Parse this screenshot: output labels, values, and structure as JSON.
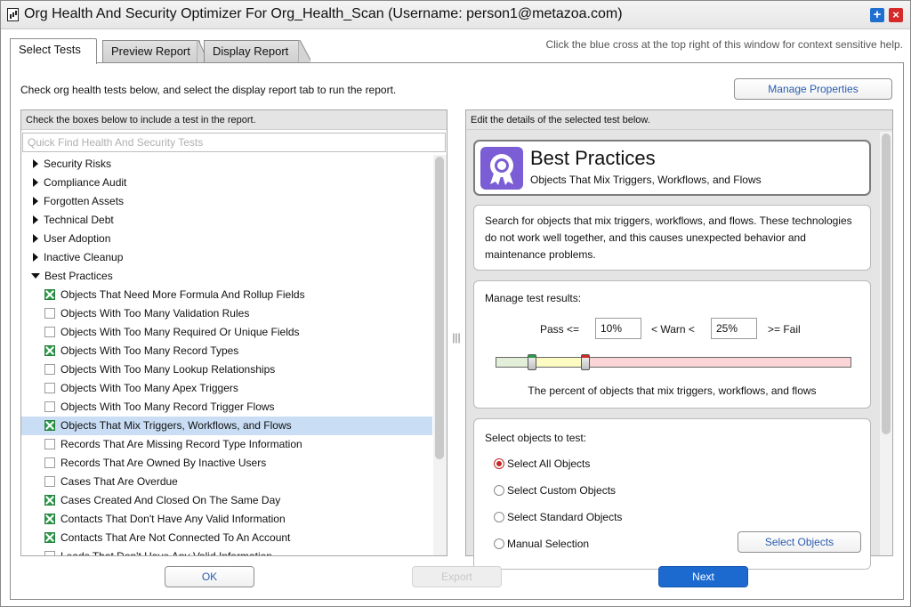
{
  "window": {
    "title": "Org Health And Security Optimizer For Org_Health_Scan (Username: person1@metazoa.com)",
    "help_glyph": "+",
    "close_glyph": "×"
  },
  "tabs": [
    {
      "label": "Select Tests",
      "active": true
    },
    {
      "label": "Preview Report",
      "active": false
    },
    {
      "label": "Display Report",
      "active": false
    }
  ],
  "help_text": "Click the blue cross at the top right of this window for context sensitive help.",
  "instruction": "Check org health tests below, and select the display report tab to run the report.",
  "manage_properties_label": "Manage Properties",
  "left": {
    "header": "Check the boxes below to include a test in the report.",
    "search_placeholder": "Quick Find Health And Security Tests",
    "categories": [
      "Security Risks",
      "Compliance Audit",
      "Forgotten Assets",
      "Technical Debt",
      "User Adoption",
      "Inactive Cleanup"
    ],
    "expanded_category": "Best Practices",
    "tests": [
      {
        "label": "Objects That Need More Formula And Rollup Fields",
        "checked": true
      },
      {
        "label": "Objects With Too Many Validation Rules",
        "checked": false
      },
      {
        "label": "Objects With Too Many Required Or Unique Fields",
        "checked": false
      },
      {
        "label": "Objects With Too Many Record Types",
        "checked": true
      },
      {
        "label": "Objects With Too Many Lookup Relationships",
        "checked": false
      },
      {
        "label": "Objects With Too Many Apex Triggers",
        "checked": false
      },
      {
        "label": "Objects With Too Many Record Trigger Flows",
        "checked": false
      },
      {
        "label": "Objects That Mix Triggers, Workflows, and Flows",
        "checked": true,
        "selected": true
      },
      {
        "label": "Records That Are Missing Record Type Information",
        "checked": false
      },
      {
        "label": "Records That Are Owned By Inactive Users",
        "checked": false
      },
      {
        "label": "Cases That Are Overdue",
        "checked": false
      },
      {
        "label": "Cases Created And Closed On The Same Day",
        "checked": true
      },
      {
        "label": "Contacts That Don't Have Any Valid Information",
        "checked": true
      },
      {
        "label": "Contacts That Are Not Connected To An Account",
        "checked": true
      },
      {
        "label": "Leads That Don't Have Any Valid Information",
        "checked": false
      }
    ]
  },
  "right": {
    "header": "Edit the details of the selected test below.",
    "title": "Best Practices",
    "subtitle": "Objects That Mix Triggers, Workflows, and Flows",
    "description": "Search for objects that mix triggers, workflows, and flows. These technologies do not work well together, and this causes unexpected behavior and maintenance problems.",
    "manage_label": "Manage test results:",
    "pass_label": "Pass <=",
    "pass_value": "10%",
    "warn_label": "< Warn <",
    "warn_value": "25%",
    "fail_label": ">= Fail",
    "pass_fraction": 0.1,
    "warn_fraction": 0.25,
    "slider_caption": "The percent of objects that mix triggers, workflows, and flows",
    "select_label": "Select objects to test:",
    "radio_options": [
      {
        "label": "Select All Objects",
        "selected": true
      },
      {
        "label": "Select Custom Objects",
        "selected": false
      },
      {
        "label": "Select Standard Objects",
        "selected": false
      },
      {
        "label": "Manual Selection",
        "selected": false
      }
    ],
    "select_objects_label": "Select Objects"
  },
  "footer": {
    "ok_label": "OK",
    "export_label": "Export",
    "next_label": "Next"
  },
  "colors": {
    "accent": "#1c6ad0",
    "check_green": "#2d9a4b",
    "selected_row": "#c9ddf5",
    "icon_purple": "#7b5ed6"
  }
}
